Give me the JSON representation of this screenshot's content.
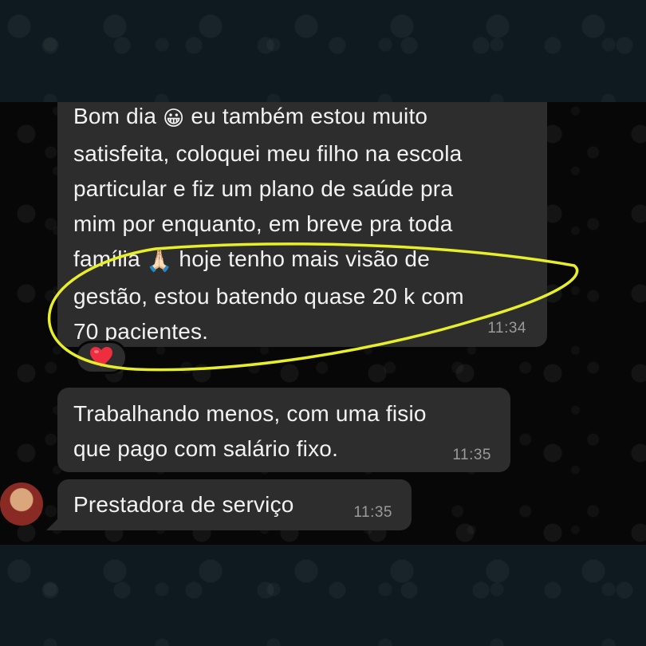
{
  "messages": [
    {
      "text_part1": "Bom dia ",
      "emoji1": "😀",
      "text_part2": " eu também estou muito\nsatisfeita, coloquei meu filho na escola\nparticular e fiz um plano de saúde pra\nmim por enquanto, em breve pra toda\nfamília ",
      "emoji2": "🙏🏻",
      "text_part3": " hoje tenho mais visão de\ngestão, estou batendo quase 20 k com\n70 pacientes.",
      "time": "11:34",
      "reaction": "❤️"
    },
    {
      "text": "Trabalhando menos, com uma fisio\nque pago com salário fixo.",
      "time": "11:35"
    },
    {
      "text": "Prestadora de serviço",
      "time": "11:35"
    }
  ],
  "colors": {
    "bubble": "#2d2d2d",
    "text": "#f2f2f2",
    "timestamp": "#9a9a9a",
    "highlight": "#e8ef2a"
  },
  "icons": [
    "grinning-face-emoji",
    "folded-hands-emoji",
    "heart-reaction-icon",
    "contact-avatar"
  ]
}
